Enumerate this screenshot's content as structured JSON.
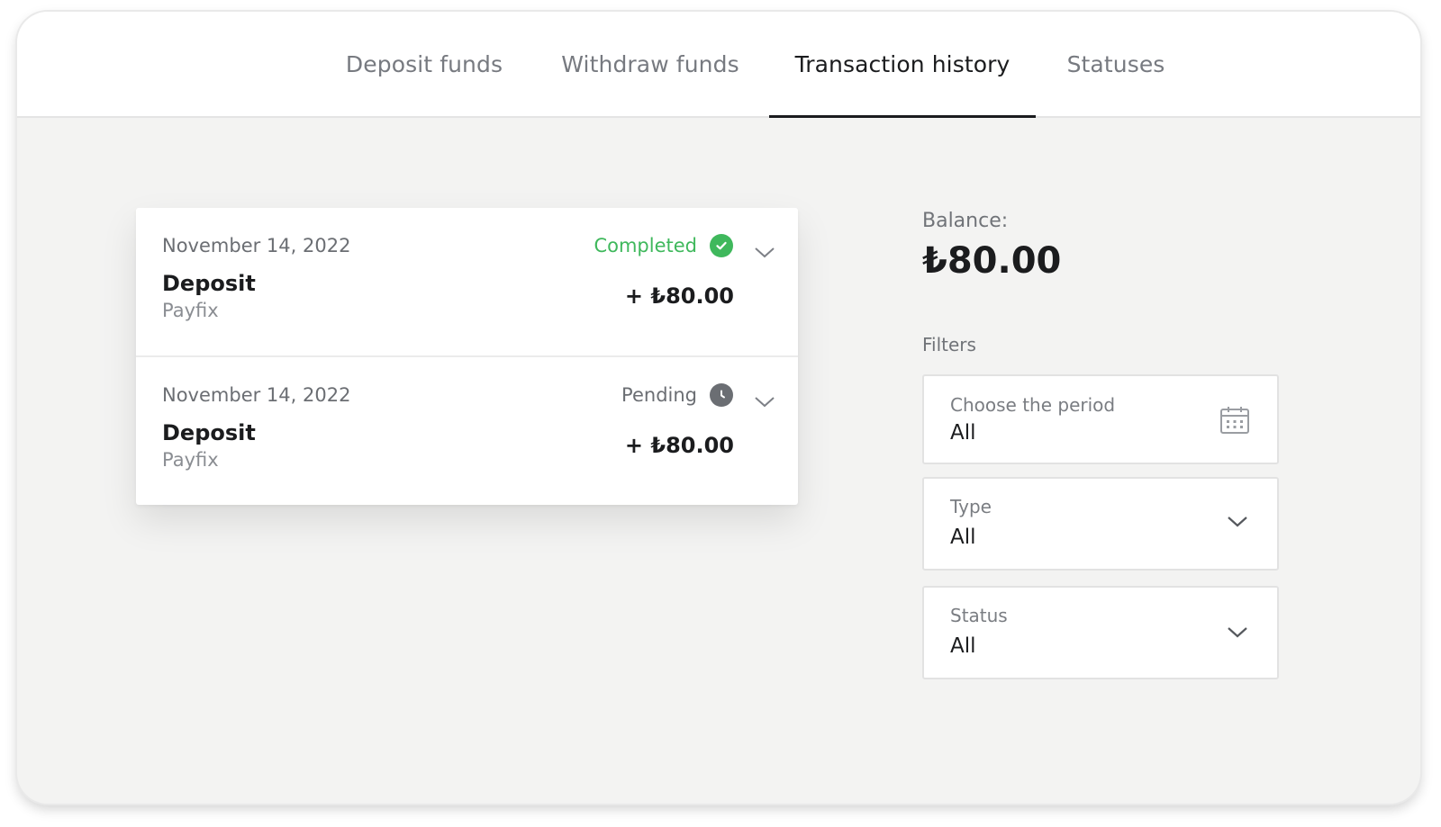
{
  "tabs": [
    {
      "label": "Deposit funds",
      "active": false
    },
    {
      "label": "Withdraw funds",
      "active": false
    },
    {
      "label": "Transaction history",
      "active": true
    },
    {
      "label": "Statuses",
      "active": false
    }
  ],
  "transactions": [
    {
      "date": "November 14, 2022",
      "type": "Deposit",
      "method": "Payfix",
      "status": "Completed",
      "status_icon": "check-circle-icon",
      "status_color": "#3fb85c",
      "amount": "+ ₺80.00"
    },
    {
      "date": "November 14, 2022",
      "type": "Deposit",
      "method": "Payfix",
      "status": "Pending",
      "status_icon": "clock-icon",
      "status_color": "#6b6e73",
      "amount": "+ ₺80.00"
    }
  ],
  "balance": {
    "label": "Balance:",
    "value": "₺80.00"
  },
  "filters": {
    "label": "Filters",
    "period": {
      "label": "Choose the period",
      "value": "All",
      "icon": "calendar-icon"
    },
    "type": {
      "label": "Type",
      "value": "All",
      "icon": "chevron-down-icon"
    },
    "status": {
      "label": "Status",
      "value": "All",
      "icon": "chevron-down-icon"
    }
  },
  "colors": {
    "accent": "#1b1c1e",
    "success": "#3fb85c",
    "muted": "#777a80"
  }
}
